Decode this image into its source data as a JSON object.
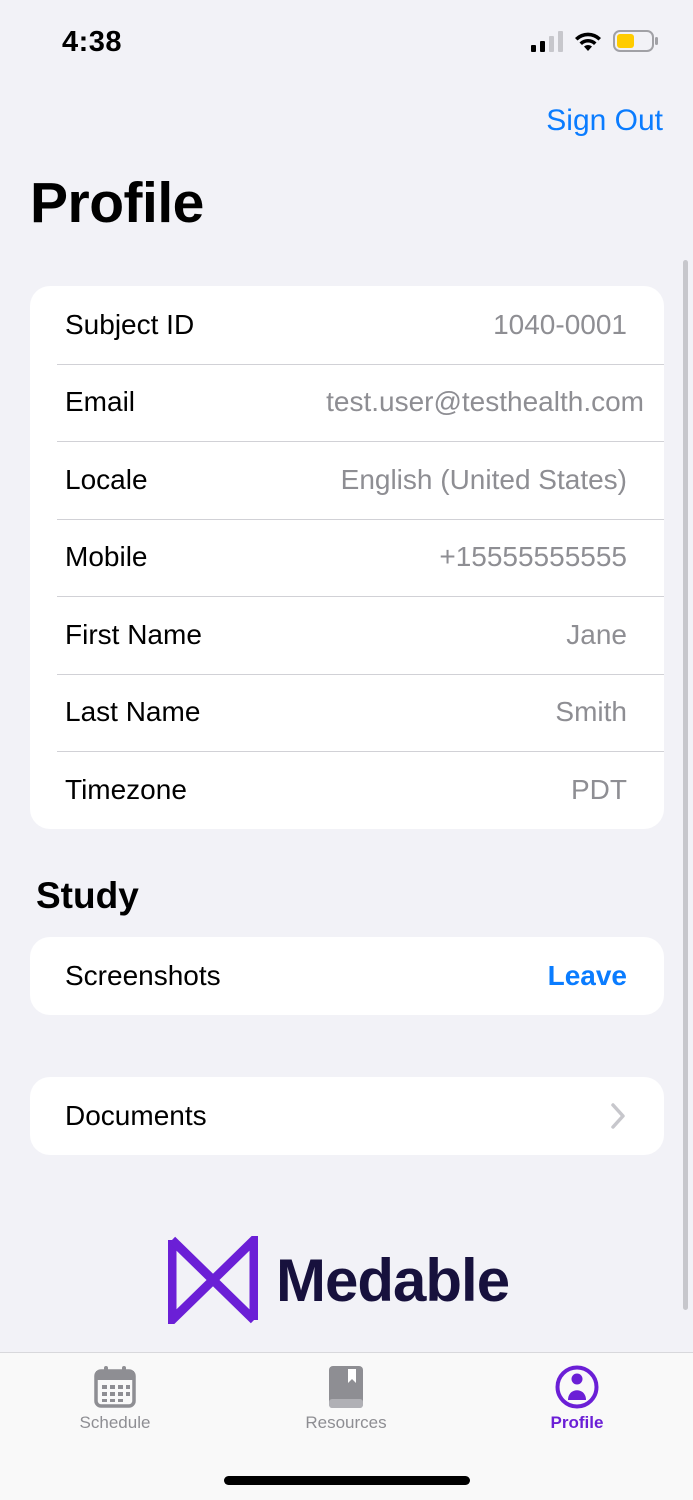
{
  "status_bar": {
    "time": "4:38"
  },
  "nav": {
    "sign_out": "Sign Out",
    "title": "Profile"
  },
  "profile_rows": [
    {
      "label": "Subject ID",
      "value": "1040-0001"
    },
    {
      "label": "Email",
      "value": "test.user@testhealth.com"
    },
    {
      "label": "Locale",
      "value": "English (United States)"
    },
    {
      "label": "Mobile",
      "value": "+15555555555"
    },
    {
      "label": "First Name",
      "value": "Jane"
    },
    {
      "label": "Last Name",
      "value": "Smith"
    },
    {
      "label": "Timezone",
      "value": "PDT"
    }
  ],
  "study": {
    "header": "Study",
    "name": "Screenshots",
    "leave": "Leave"
  },
  "documents": {
    "label": "Documents"
  },
  "logo": {
    "text": "Medable"
  },
  "tabs": [
    {
      "label": "Schedule",
      "icon": "calendar-icon"
    },
    {
      "label": "Resources",
      "icon": "book-icon"
    },
    {
      "label": "Profile",
      "icon": "person-icon"
    }
  ],
  "colors": {
    "accent": "#0a7cff",
    "brand": "#6b1fd6",
    "brand_dark": "#17113d",
    "background": "#f2f2f7",
    "secondary_text": "#8e8e93"
  }
}
